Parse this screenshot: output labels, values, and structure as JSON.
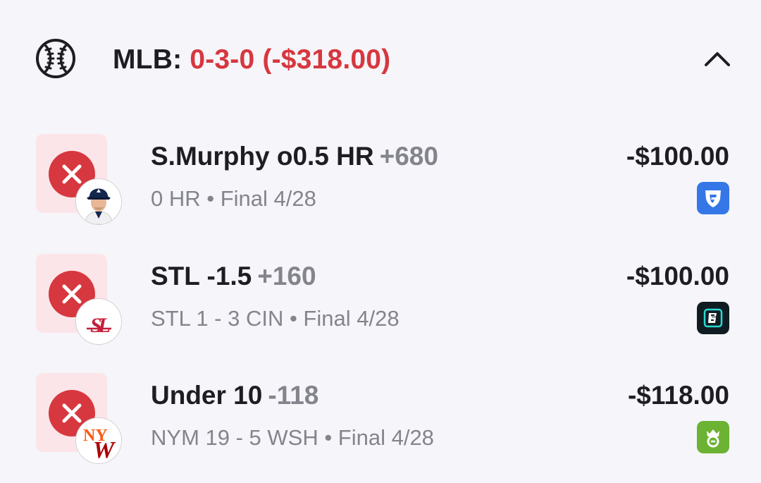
{
  "header": {
    "league": "MLB:",
    "record": "0-3-0 (-$318.00)",
    "icon": "baseball-icon",
    "collapse_icon": "chevron-up-icon"
  },
  "bets": [
    {
      "title": "S.Murphy o0.5 HR",
      "odds": "+680",
      "subtitle": "0 HR • Final 4/28",
      "amount": "-$100.00",
      "status": "lost",
      "logo": "player-headshot",
      "book": "fanduel-logo",
      "book_color": "#3677e8"
    },
    {
      "title": "STL -1.5",
      "odds": "+160",
      "subtitle": "STL 1 - 3 CIN • Final 4/28",
      "amount": "-$100.00",
      "status": "lost",
      "logo": "cardinals-logo",
      "book": "espnbet-logo",
      "book_color": "#0f1c22"
    },
    {
      "title": "Under 10",
      "odds": "-118",
      "subtitle": "NYM 19 - 5 WSH • Final 4/28",
      "amount": "-$118.00",
      "status": "lost",
      "logo": "mets-nationals-logo",
      "book": "draftkings-logo",
      "book_color": "#6cb233"
    }
  ],
  "colors": {
    "loss_red": "#d7373f",
    "tile_bg": "#fbe5e8",
    "muted_text": "#84848d",
    "background": "#f5f5fa"
  }
}
